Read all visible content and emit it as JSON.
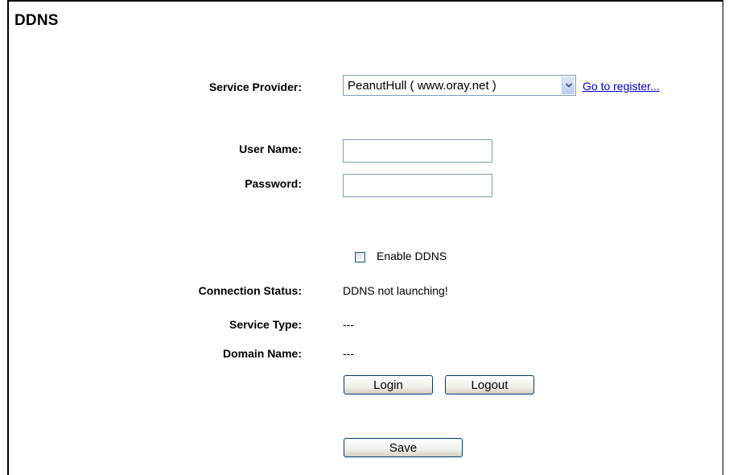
{
  "header": {
    "title": "DDNS"
  },
  "form": {
    "service_provider": {
      "label": "Service Provider:",
      "selected": "PeanutHull ( www.oray.net )",
      "register_link": "Go to register..."
    },
    "user_name": {
      "label": "User Name:",
      "value": ""
    },
    "password": {
      "label": "Password:",
      "value": ""
    },
    "enable_ddns": {
      "label": "Enable DDNS",
      "checked": false
    },
    "connection_status": {
      "label": "Connection Status:",
      "value": "DDNS not launching!"
    },
    "service_type": {
      "label": "Service Type:",
      "value": "---"
    },
    "domain_name": {
      "label": "Domain Name:",
      "value": "---"
    }
  },
  "buttons": {
    "login": "Login",
    "logout": "Logout",
    "save": "Save"
  },
  "colors": {
    "link": "#0000cc",
    "input_border": "#7f9db9",
    "button_border": "#003c74"
  },
  "icons": {
    "dropdown": "chevron-down-icon"
  }
}
